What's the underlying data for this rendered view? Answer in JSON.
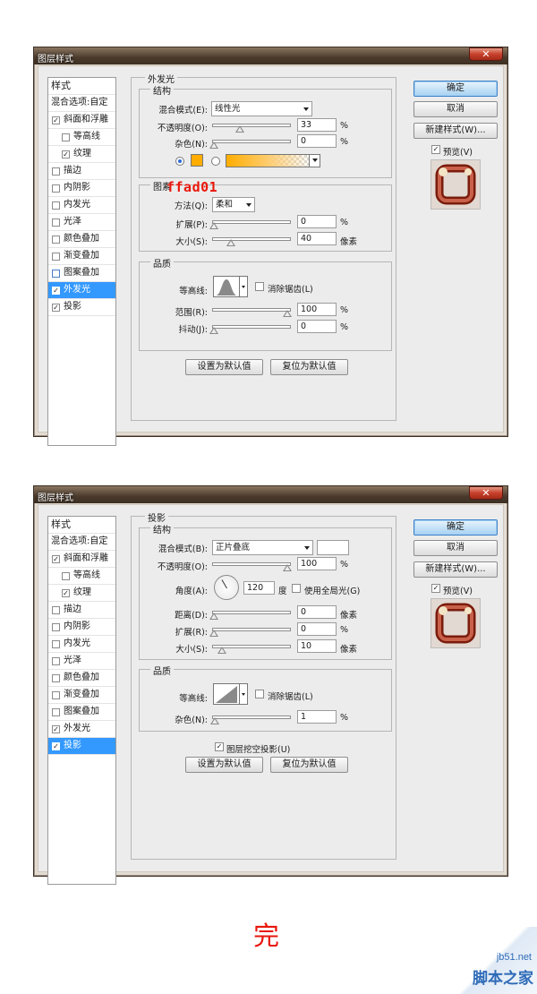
{
  "dialog1": {
    "title": "图层样式",
    "close": "✕",
    "list": {
      "header": "样式",
      "blend": "混合选项:自定",
      "items": [
        {
          "label": "斜面和浮雕",
          "checked": "✓"
        },
        {
          "label": "等高线",
          "checked": ""
        },
        {
          "label": "纹理",
          "checked": "✓"
        },
        {
          "label": "描边",
          "checked": ""
        },
        {
          "label": "内阴影",
          "checked": ""
        },
        {
          "label": "内发光",
          "checked": ""
        },
        {
          "label": "光泽",
          "checked": ""
        },
        {
          "label": "颜色叠加",
          "checked": ""
        },
        {
          "label": "渐变叠加",
          "checked": ""
        },
        {
          "label": "图案叠加",
          "checked": ""
        },
        {
          "label": "外发光",
          "checked": "✓"
        },
        {
          "label": "投影",
          "checked": "✓"
        }
      ]
    },
    "panel_title": "外发光",
    "structure": {
      "title": "结构",
      "blend_label": "混合模式(E):",
      "blend_value": "线性光",
      "opacity_label": "不透明度(O):",
      "opacity_value": "33",
      "noise_label": "杂色(N):",
      "noise_value": "0",
      "unit_percent": "%"
    },
    "annotation": "ffad01",
    "elements": {
      "title": "图素",
      "method_label": "方法(Q):",
      "method_value": "柔和",
      "spread_label": "扩展(P):",
      "spread_value": "0",
      "size_label": "大小(S):",
      "size_value": "40",
      "unit_percent": "%",
      "unit_px": "像素"
    },
    "quality": {
      "title": "品质",
      "contour_label": "等高线:",
      "antialias_label": "消除锯齿(L)",
      "range_label": "范围(R):",
      "range_value": "100",
      "jitter_label": "抖动(J):",
      "jitter_value": "0",
      "unit_percent": "%"
    },
    "set_default": "设置为默认值",
    "reset_default": "复位为默认值",
    "ok": "确定",
    "cancel": "取消",
    "new_style": "新建样式(W)...",
    "preview_label": "预览(V)",
    "preview_checked": "✓"
  },
  "dialog2": {
    "title": "图层样式",
    "close": "✕",
    "list": {
      "header": "样式",
      "blend": "混合选项:自定",
      "items": [
        {
          "label": "斜面和浮雕",
          "checked": "✓"
        },
        {
          "label": "等高线",
          "checked": ""
        },
        {
          "label": "纹理",
          "checked": "✓"
        },
        {
          "label": "描边",
          "checked": ""
        },
        {
          "label": "内阴影",
          "checked": ""
        },
        {
          "label": "内发光",
          "checked": ""
        },
        {
          "label": "光泽",
          "checked": ""
        },
        {
          "label": "颜色叠加",
          "checked": ""
        },
        {
          "label": "渐变叠加",
          "checked": ""
        },
        {
          "label": "图案叠加",
          "checked": ""
        },
        {
          "label": "外发光",
          "checked": "✓"
        },
        {
          "label": "投影",
          "checked": "✓"
        }
      ]
    },
    "panel_title": "投影",
    "structure": {
      "title": "结构",
      "blend_label": "混合模式(B):",
      "blend_value": "正片叠底",
      "opacity_label": "不透明度(O):",
      "opacity_value": "100",
      "angle_label": "角度(A):",
      "angle_value": "120",
      "angle_unit": "度",
      "global_light_label": "使用全局光(G)",
      "distance_label": "距离(D):",
      "distance_value": "0",
      "spread_label": "扩展(R):",
      "spread_value": "0",
      "size_label": "大小(S):",
      "size_value": "10",
      "unit_percent": "%",
      "unit_px": "像素"
    },
    "quality": {
      "title": "品质",
      "contour_label": "等高线:",
      "antialias_label": "消除锯齿(L)",
      "noise_label": "杂色(N):",
      "noise_value": "1",
      "unit_percent": "%"
    },
    "knockout_label": "图层挖空投影(U)",
    "knockout_checked": "✓",
    "set_default": "设置为默认值",
    "reset_default": "复位为默认值",
    "ok": "确定",
    "cancel": "取消",
    "new_style": "新建样式(W)...",
    "preview_label": "预览(V)",
    "preview_checked": "✓"
  },
  "footer_text": "完",
  "watermark": {
    "domain": "jb51.net",
    "name": "脚本之家"
  },
  "colors": {
    "glow": "#ffad01",
    "accent": "#3399ff",
    "annotation": "#e8160c"
  }
}
